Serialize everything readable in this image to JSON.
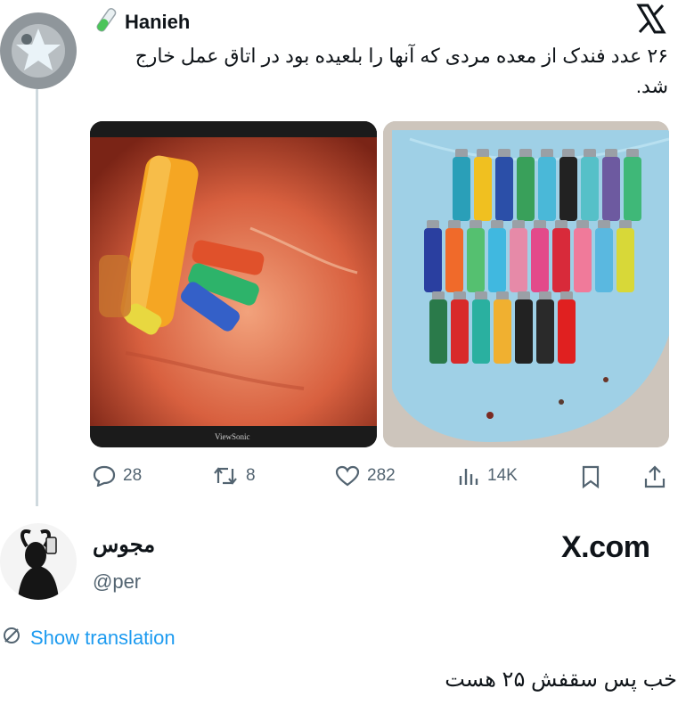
{
  "tweet": {
    "author": "Hanieh",
    "author_emoji_icon": "test-tube-icon",
    "platform_icon": "x-logo-icon",
    "text": "۲۶ عدد فندک از معده مردی که آنها را بلعیده بود در اتاق عمل خارج شد.",
    "screen_brand": "ViewSonic",
    "actions": {
      "replies": "28",
      "reposts": "8",
      "likes": "282",
      "views": "14K"
    }
  },
  "reply": {
    "author": "مجوس",
    "handle": "@per",
    "site_label": "X.com",
    "translate_label": "Show translation",
    "text": "خب پس سقفش ۲۵ هست"
  },
  "colors": {
    "text": "#0f1419",
    "muted": "#536471",
    "link": "#1d9bf0",
    "thread_line": "#cfd9de"
  }
}
